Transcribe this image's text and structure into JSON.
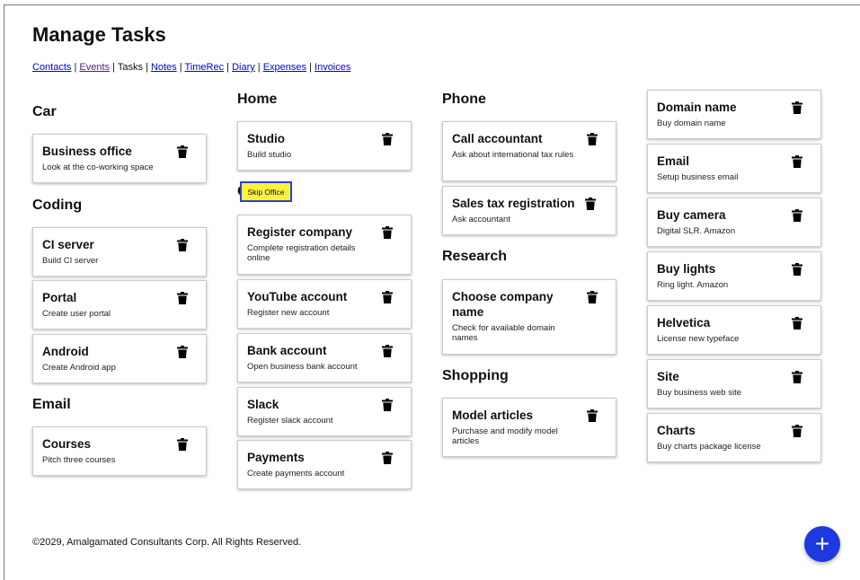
{
  "page": {
    "title": "Manage Tasks"
  },
  "nav": {
    "links": [
      "Contacts",
      "Events",
      "Tasks",
      "Notes",
      "TimeRec",
      "Diary",
      "Expenses",
      "Invoices"
    ],
    "current": "Tasks",
    "separator": " | "
  },
  "columns": [
    {
      "groups": [
        {
          "name": "Car",
          "tasks": [
            {
              "title": "Business office",
              "desc": "Look at the co-working space"
            }
          ]
        },
        {
          "name": "Coding",
          "tasks": [
            {
              "title": "CI server",
              "desc": "Build CI server"
            },
            {
              "title": "Portal",
              "desc": "Create user portal"
            },
            {
              "title": "Android",
              "desc": "Create Android app"
            }
          ]
        },
        {
          "name": "Email",
          "tasks": [
            {
              "title": "Courses",
              "desc": "Pitch three courses"
            }
          ]
        }
      ]
    },
    {
      "groups": [
        {
          "name": "Home",
          "tasks": [
            {
              "title": "Studio",
              "desc": "Build studio"
            }
          ]
        },
        {
          "name": "O",
          "tasks": [
            {
              "title": "Register company",
              "desc": "Complete registration details online"
            },
            {
              "title": "YouTube account",
              "desc": "Register new account"
            },
            {
              "title": "Bank account",
              "desc": "Open business bank account"
            },
            {
              "title": "Slack",
              "desc": "Register slack account"
            },
            {
              "title": "Payments",
              "desc": "Create payments account"
            }
          ]
        }
      ]
    },
    {
      "groups": [
        {
          "name": "Phone",
          "tasks": [
            {
              "title": "Call accountant",
              "desc": "Ask about international tax rules"
            },
            {
              "title": "Sales tax registration",
              "desc": "Ask accountant"
            }
          ]
        },
        {
          "name": "Research",
          "tasks": [
            {
              "title": "Choose company name",
              "desc": "Check for available domain names"
            }
          ]
        },
        {
          "name": "Shopping",
          "tasks": [
            {
              "title": "Model articles",
              "desc": "Purchase and modify model articles"
            }
          ]
        }
      ]
    },
    {
      "groups": [
        {
          "name": "",
          "tasks": [
            {
              "title": "Domain name",
              "desc": "Buy domain name"
            },
            {
              "title": "Email",
              "desc": "Setup business email"
            },
            {
              "title": "Buy camera",
              "desc": "Digital SLR. Amazon"
            },
            {
              "title": "Buy lights",
              "desc": "Ring light. Amazon"
            },
            {
              "title": "Helvetica",
              "desc": "License new typeface"
            },
            {
              "title": "Site",
              "desc": "Buy business web site"
            },
            {
              "title": "Charts",
              "desc": "Buy charts package license"
            }
          ]
        }
      ]
    }
  ],
  "tooltip": {
    "text": "Skip Office"
  },
  "footer": {
    "text": "©2029, Amalgamated Consultants Corp. All Rights Reserved."
  },
  "fab": {
    "label": "+"
  },
  "icons": {
    "delete": "trash-icon",
    "add": "plus-icon"
  },
  "colors": {
    "link": "#0000ee",
    "fab": "#1d39e0",
    "tooltip_bg": "#fcf23a",
    "tooltip_border": "#2b3fd6"
  }
}
